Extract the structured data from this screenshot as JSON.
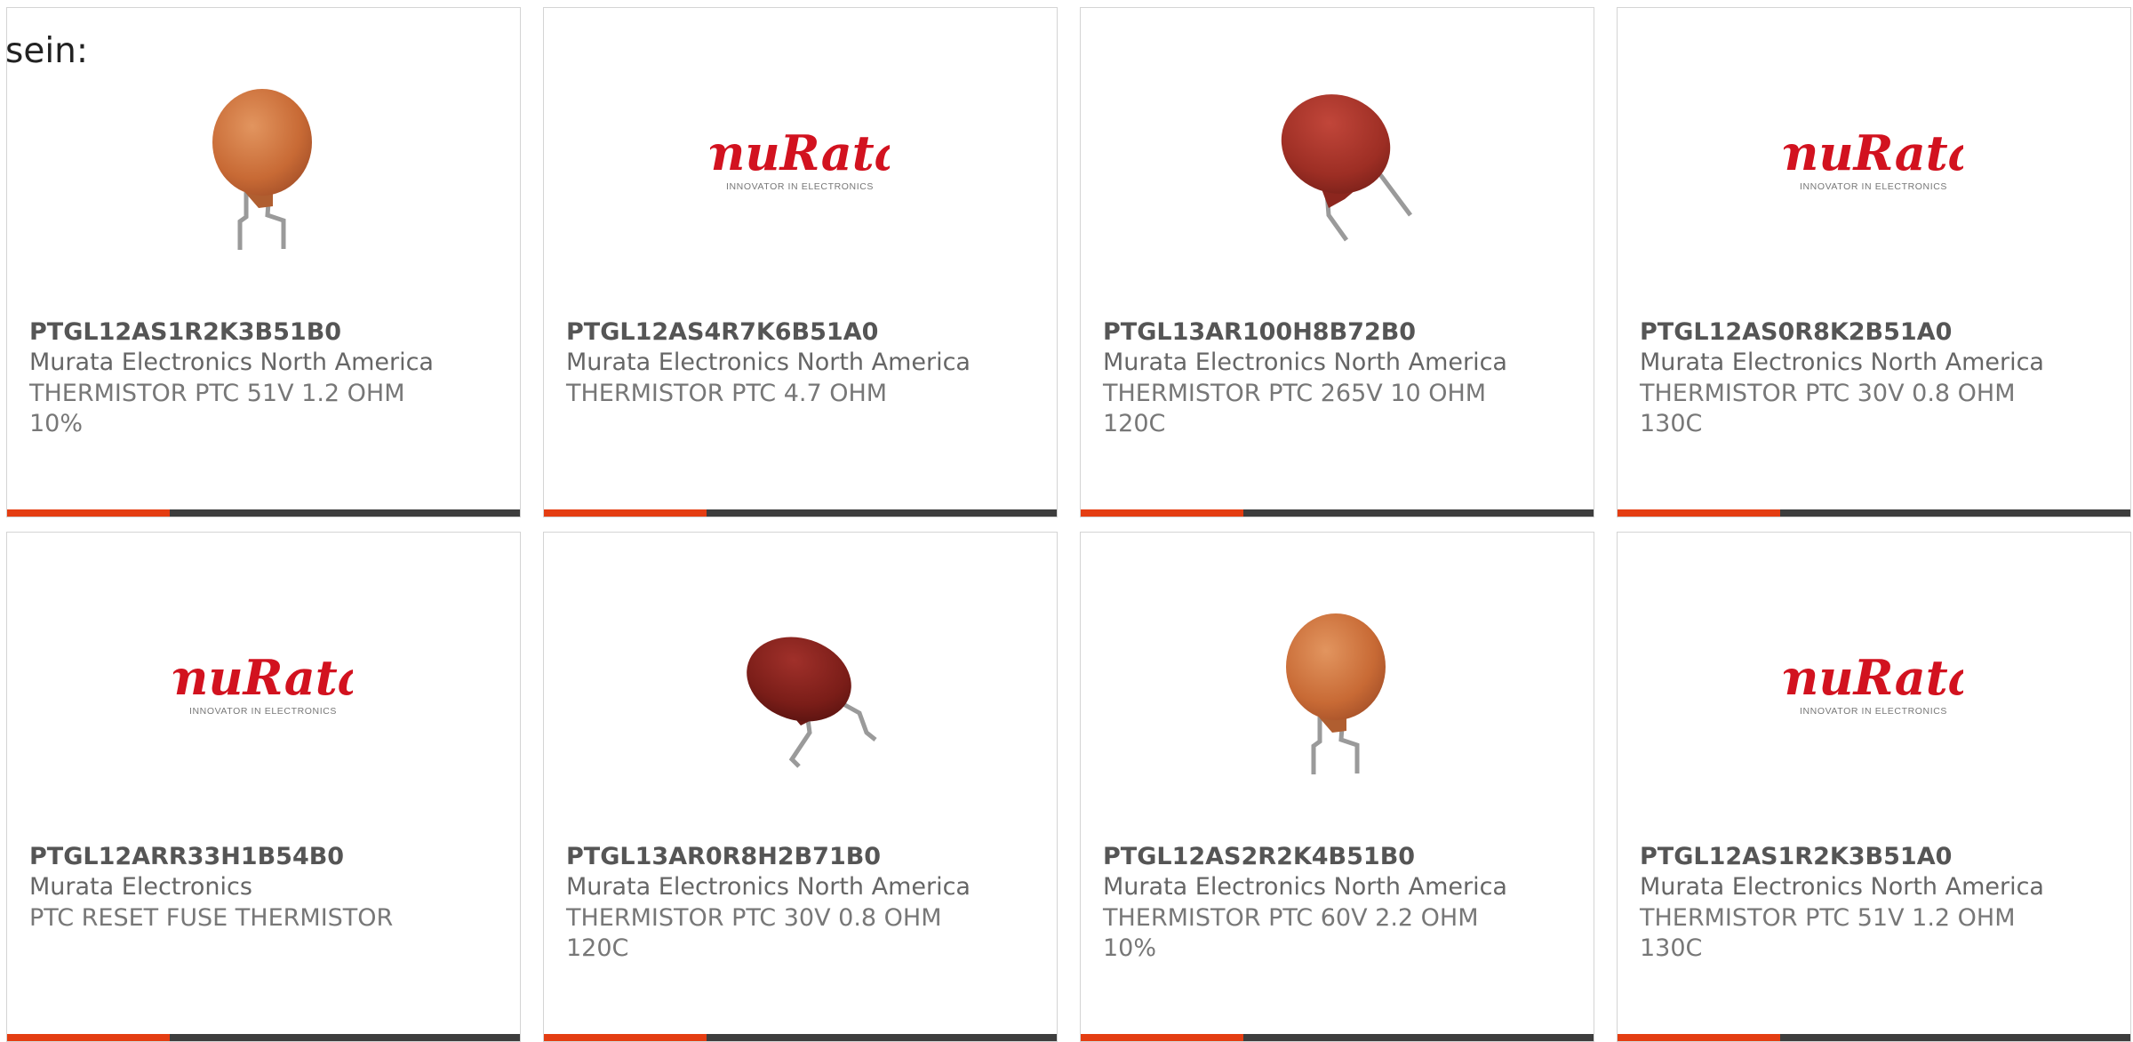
{
  "intro_text": "sein:",
  "colors": {
    "accent": "#e43d12",
    "bar": "#3d3d3d",
    "border": "#d4d4d4"
  },
  "logo": {
    "brand": "muRata",
    "tagline": "INNOVATOR IN ELECTRONICS"
  },
  "products": [
    {
      "part_number": "PTGL12AS1R2K3B51B0",
      "manufacturer": "Murata Electronics North America",
      "description": "THERMISTOR PTC 51V 1.2 OHM 10%",
      "image": "thermistor-orange-photo"
    },
    {
      "part_number": "PTGL12AS4R7K6B51A0",
      "manufacturer": "Murata Electronics North America",
      "description": "THERMISTOR PTC 4.7 OHM",
      "image": "murata-logo"
    },
    {
      "part_number": "PTGL13AR100H8B72B0",
      "manufacturer": "Murata Electronics North America",
      "description": "THERMISTOR PTC 265V 10 OHM 120C",
      "image": "thermistor-red-photo"
    },
    {
      "part_number": "PTGL12AS0R8K2B51A0",
      "manufacturer": "Murata Electronics North America",
      "description": "THERMISTOR PTC 30V 0.8 OHM 130C",
      "image": "murata-logo"
    },
    {
      "part_number": "PTGL12ARR33H1B54B0",
      "manufacturer": "Murata Electronics",
      "description": "PTC RESET FUSE THERMISTOR",
      "image": "murata-logo"
    },
    {
      "part_number": "PTGL13AR0R8H2B71B0",
      "manufacturer": "Murata Electronics North America",
      "description": "THERMISTOR PTC 30V 0.8 OHM 120C",
      "image": "thermistor-darkred-photo"
    },
    {
      "part_number": "PTGL12AS2R2K4B51B0",
      "manufacturer": "Murata Electronics North America",
      "description": "THERMISTOR PTC 60V 2.2 OHM 10%",
      "image": "thermistor-orange-photo"
    },
    {
      "part_number": "PTGL12AS1R2K3B51A0",
      "manufacturer": "Murata Electronics North America",
      "description": "THERMISTOR PTC 51V 1.2 OHM 130C",
      "image": "murata-logo"
    }
  ]
}
